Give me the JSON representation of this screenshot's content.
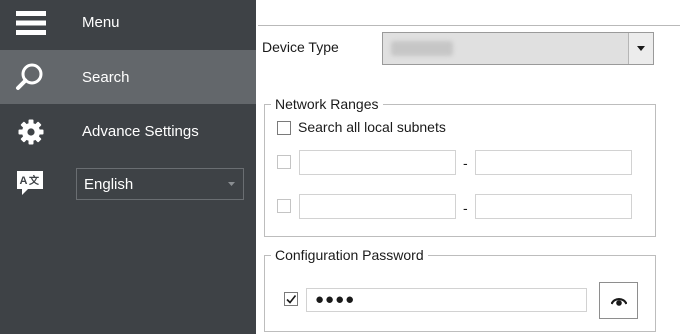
{
  "sidebar": {
    "menu_label": "Menu",
    "items": [
      {
        "label": "Search",
        "icon": "search-icon",
        "active": true
      },
      {
        "label": "Advance Settings",
        "icon": "gear-icon",
        "active": false
      }
    ],
    "language": {
      "icon": "translate-icon",
      "selected": "English"
    }
  },
  "main": {
    "device_type": {
      "label": "Device Type",
      "value": ""
    },
    "network_ranges": {
      "legend": "Network Ranges",
      "search_all_label": "Search all local subnets",
      "search_all_checked": false,
      "ranges": [
        {
          "enabled": false,
          "from": "",
          "to": "",
          "separator": "-"
        },
        {
          "enabled": false,
          "from": "",
          "to": "",
          "separator": "-"
        }
      ]
    },
    "configuration_password": {
      "legend": "Configuration Password",
      "enabled": true,
      "value_masked": "●●●●",
      "reveal_icon": "eye-icon"
    }
  },
  "colors": {
    "sidebar_bg": "#3e4246",
    "sidebar_active": "#63676b",
    "sidebar_text": "#ffffff"
  }
}
